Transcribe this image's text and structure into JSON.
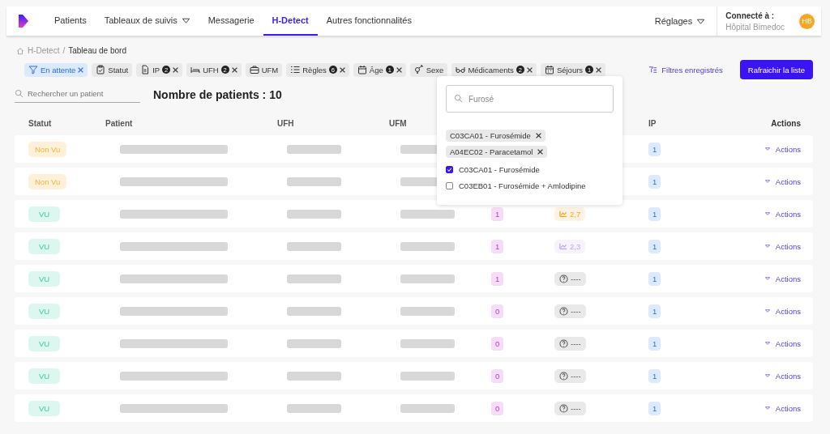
{
  "nav": {
    "items": [
      {
        "label": "Patients",
        "selected": false,
        "dropdown": false
      },
      {
        "label": "Tableaux de suivis",
        "selected": false,
        "dropdown": true
      },
      {
        "label": "Messagerie",
        "selected": false,
        "dropdown": false
      },
      {
        "label": "H-Detect",
        "selected": true,
        "dropdown": false
      },
      {
        "label": "Autres fonctionnalités",
        "selected": false,
        "dropdown": false
      }
    ],
    "settings": "Réglages",
    "connected_label": "Connecté à :",
    "hospital": "Hôpital Bimedoc",
    "avatar": "HB"
  },
  "breadcrumb": {
    "items": [
      "H-Detect",
      "Tableau de bord"
    ],
    "separator": "/"
  },
  "filters": [
    {
      "label": "En attente",
      "removable": true,
      "selected": true
    },
    {
      "label": "Statut",
      "removable": false,
      "selected": false
    },
    {
      "label": "IP",
      "count": "2",
      "removable": true,
      "selected": false
    },
    {
      "label": "UFH",
      "count": "2",
      "removable": true,
      "selected": false
    },
    {
      "label": "UFM",
      "removable": false,
      "selected": false
    },
    {
      "label": "Règles",
      "count": "6",
      "removable": true,
      "selected": false
    },
    {
      "label": "Âge",
      "count": "1",
      "removable": true,
      "selected": false
    },
    {
      "label": "Sexe",
      "removable": false,
      "selected": false
    },
    {
      "label": "Médicaments",
      "count": "2",
      "removable": true,
      "selected": false
    },
    {
      "label": "Séjours",
      "count": "1",
      "removable": true,
      "selected": false
    }
  ],
  "saved_filters": "Filtres enregistrés",
  "refresh_button": "Rafraichir la liste",
  "search": {
    "placeholder": "Rechercher un patient"
  },
  "patient_count": "Nombre de patients : 10",
  "dropdown": {
    "search_value": "Furosé",
    "tags": [
      "C03CA01 - Furosémide",
      "A04EC02 - Paracetamol"
    ],
    "options": [
      {
        "label": "C03CA01 - Furosémide",
        "checked": true
      },
      {
        "label": "C03EB01 - Furosémide + Amlodipine",
        "checked": false
      }
    ]
  },
  "table": {
    "columns": [
      "Statut",
      "Patient",
      "UFH",
      "UFM",
      "IP",
      "Actions"
    ],
    "rows": [
      {
        "status": "Non Vu",
        "kind": "pending",
        "ip": "1",
        "action": "Actions"
      },
      {
        "status": "Non Vu",
        "kind": "pending",
        "ip": "1",
        "action": "Actions"
      },
      {
        "status": "VU",
        "kind": "seen",
        "count": "1",
        "trend": {
          "kind": "trend",
          "value": "2,7",
          "color": "#f5a623"
        },
        "ip": "1",
        "action": "Actions"
      },
      {
        "status": "VU",
        "kind": "seen",
        "count": "1",
        "trend": {
          "kind": "trend",
          "value": "2,3",
          "color": "#b9a6f0"
        },
        "ip": "1",
        "action": "Actions"
      },
      {
        "status": "VU",
        "kind": "seen",
        "count": "1",
        "trend": {
          "kind": "unknown",
          "value": "----"
        },
        "ip": "1",
        "action": "Actions"
      },
      {
        "status": "VU",
        "kind": "seen",
        "count": "0",
        "trend": {
          "kind": "unknown",
          "value": "----"
        },
        "ip": "1",
        "action": "Actions"
      },
      {
        "status": "VU",
        "kind": "seen",
        "count": "0",
        "trend": {
          "kind": "unknown",
          "value": "----"
        },
        "ip": "1",
        "action": "Actions"
      },
      {
        "status": "VU",
        "kind": "seen",
        "count": "0",
        "trend": {
          "kind": "unknown",
          "value": "----"
        },
        "ip": "1",
        "action": "Actions"
      },
      {
        "status": "VU",
        "kind": "seen",
        "count": "0",
        "trend": {
          "kind": "unknown",
          "value": "----"
        },
        "ip": "1",
        "action": "Actions"
      }
    ]
  }
}
